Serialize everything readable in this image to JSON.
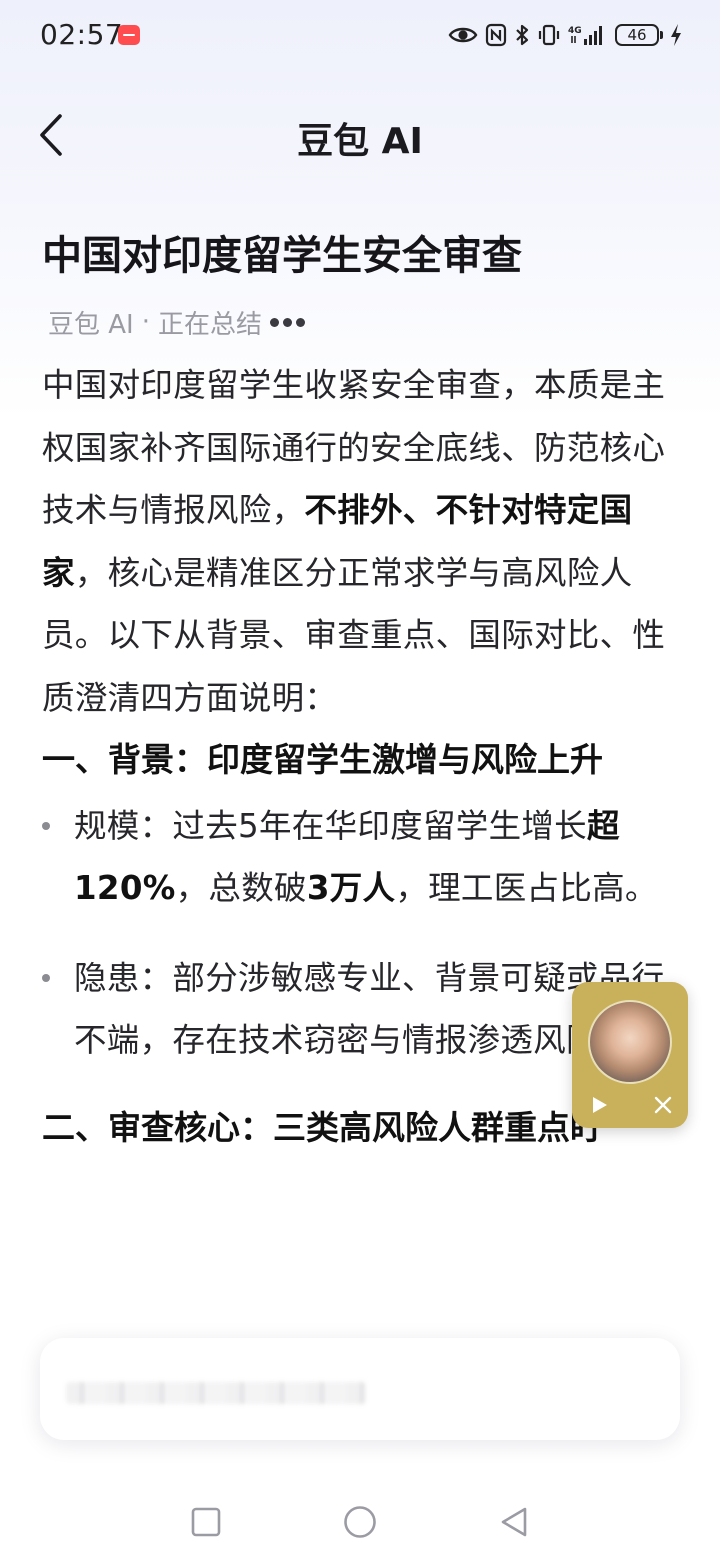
{
  "status_bar": {
    "time": "02:57",
    "battery_level": "46",
    "network": "4G",
    "icons": [
      "app-notification-icon",
      "eye-icon",
      "nfc-icon",
      "bluetooth-icon",
      "vibrate-icon",
      "signal-4g-icon",
      "battery-icon",
      "charging-bolt-icon"
    ]
  },
  "header": {
    "title": "豆包 AI",
    "back_icon": "chevron-left-icon"
  },
  "content": {
    "title": "中国对印度留学生安全审查",
    "byline": {
      "source": "豆包 AI",
      "separator": "·",
      "status": "正在总结"
    },
    "intro_parts": [
      "中国对印度留学生收紧安全审查，本质是主权国家补齐国际通行的安全底线、防范核心技术与情报风险，",
      "不排外、不针对特定国家",
      "，核心是精准区分正常求学与高风险人员。以下从背景、审查重点、国际对比、性质澄清四方面说明："
    ],
    "section1": {
      "heading": "一、背景：印度留学生激增与风险上升",
      "bullets": [
        {
          "parts": [
            "规模：过去5年在华印度留学生增长",
            "超120%",
            "，总数破",
            "3万人",
            "，理工医占比高。"
          ]
        },
        {
          "text": "隐患：部分涉敏感专业、背景可疑或品行不端，存在技术窃密与情报渗透风险。"
        }
      ]
    },
    "section2": {
      "heading": "二、审查核心：三类高风险人群重点盯"
    }
  },
  "floating_video": {
    "play_icon": "play-icon",
    "close_icon": "close-icon"
  },
  "input": {
    "placeholder": ""
  },
  "nav_bar": {
    "icons": [
      "recent-apps-icon",
      "home-icon",
      "back-triangle-icon"
    ]
  }
}
